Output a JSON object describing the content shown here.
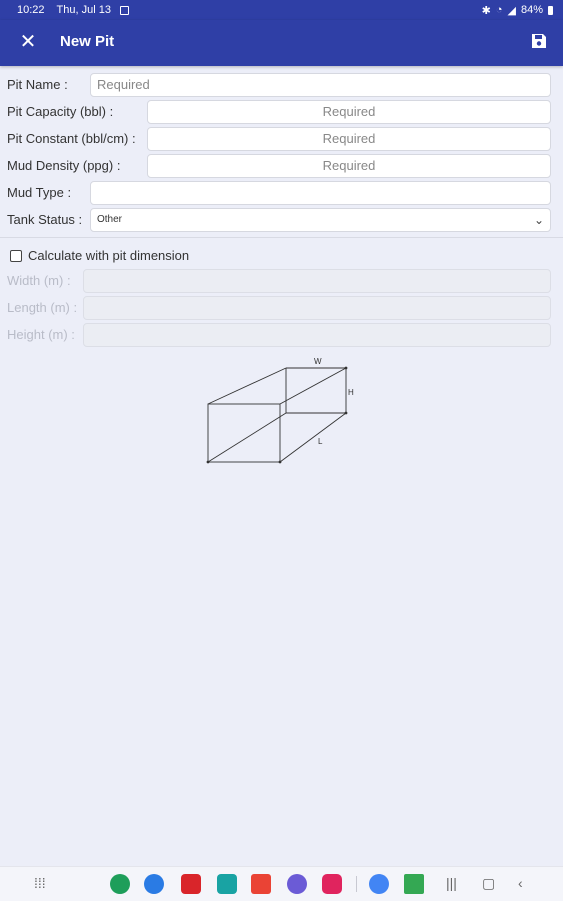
{
  "status": {
    "time": "10:22",
    "date": "Thu, Jul 13",
    "battery": "84%"
  },
  "appbar": {
    "title": "New Pit"
  },
  "form": {
    "pit_name": {
      "label": "Pit Name :",
      "placeholder": "Required"
    },
    "pit_capacity": {
      "label": "Pit Capacity (bbl) :",
      "placeholder": "Required"
    },
    "pit_constant": {
      "label": "Pit Constant (bbl/cm) :",
      "placeholder": "Required"
    },
    "mud_density": {
      "label": "Mud Density (ppg) :",
      "placeholder": "Required"
    },
    "mud_type": {
      "label": "Mud Type :",
      "value": ""
    },
    "tank_status": {
      "label": "Tank Status :",
      "selected": "Other"
    }
  },
  "dimension": {
    "checkbox_label": "Calculate with pit dimension",
    "width_label": "Width (m) :",
    "length_label": "Length (m) :",
    "height_label": "Height (m) :"
  },
  "diagram": {
    "w": "W",
    "h": "H",
    "l": "L"
  },
  "navbar": {
    "apps": [
      {
        "name": "phone",
        "color": "#1E9E5A"
      },
      {
        "name": "messages",
        "color": "#2A7BE4"
      },
      {
        "name": "flipboard",
        "color": "#D9252A"
      },
      {
        "name": "calendar",
        "color": "#19A3A3"
      },
      {
        "name": "gmail",
        "color": "#EA4335"
      },
      {
        "name": "browser",
        "color": "#6B5BD6"
      },
      {
        "name": "screen-recorder",
        "color": "#E0245E"
      },
      {
        "name": "chrome",
        "color": "#4285F4"
      },
      {
        "name": "play-store",
        "color": "#34A853"
      }
    ]
  }
}
